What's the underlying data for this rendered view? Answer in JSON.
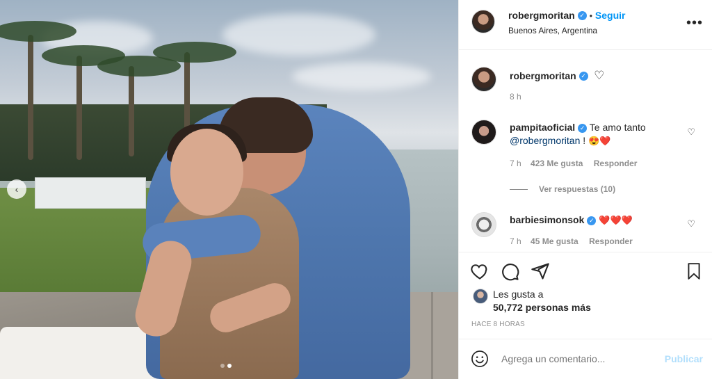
{
  "header": {
    "username": "robergmoritan",
    "verified_mark": "✓",
    "separator": "•",
    "follow_label": "Seguir",
    "location": "Buenos Aires, Argentina",
    "more_label": "•••"
  },
  "caption": {
    "username": "robergmoritan",
    "verified_mark": "✓",
    "heart_icon": "♡",
    "time": "8 h"
  },
  "comments": [
    {
      "username": "pampitaoficial",
      "verified_mark": "✓",
      "text": "Te amo tanto",
      "mention": "@robergmoritan",
      "suffix": " !",
      "emojis": "😍❤️",
      "time": "7 h",
      "likes": "423 Me gusta",
      "reply": "Responder",
      "like_icon": "♡"
    },
    {
      "username": "barbiesimonsok",
      "verified_mark": "✓",
      "emojis": "❤️❤️❤️",
      "time": "7 h",
      "likes": "45 Me gusta",
      "reply": "Responder",
      "like_icon": "♡"
    }
  ],
  "view_replies": "Ver respuestas (10)",
  "actions": {
    "like_icon": "heart-outline",
    "comment_icon": "comment-bubble",
    "share_icon": "paper-plane",
    "save_icon": "bookmark"
  },
  "likes": {
    "prefix": "Les gusta a",
    "count": "50,772 personas más"
  },
  "timestamp": "HACE 8 HORAS",
  "comment_box": {
    "placeholder": "Agrega un comentario...",
    "publish": "Publicar"
  },
  "photo": {
    "prev_label": "‹",
    "slide_index": 2,
    "slide_count": 2
  },
  "colors": {
    "accent": "#0095f6",
    "verified": "#3897f0",
    "heart_red": "#ed4956"
  }
}
